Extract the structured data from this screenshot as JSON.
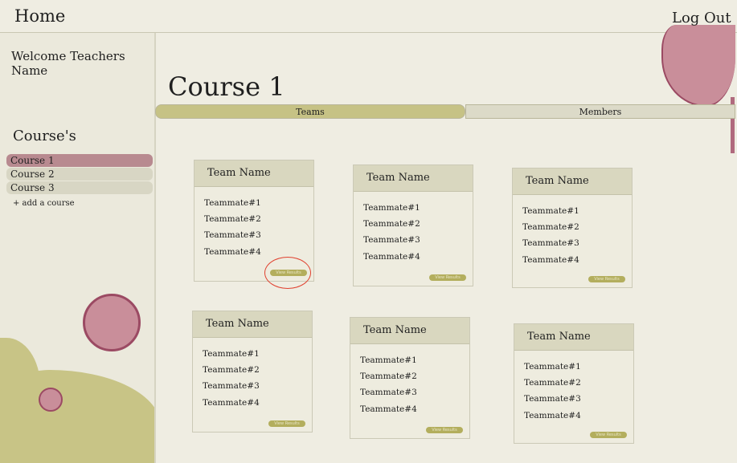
{
  "topbar": {
    "home_label": "Home",
    "logout_label": "Log Out"
  },
  "sidebar": {
    "welcome": "Welcome Teachers Name",
    "courses_heading": "Course's",
    "courses": [
      "Course 1",
      "Course 2",
      "Course 3"
    ],
    "active_course_index": 0,
    "add_course_label": "+ add a course"
  },
  "main": {
    "course_title": "Course 1",
    "tabs": [
      {
        "label": "Teams",
        "active": true
      },
      {
        "label": "Members",
        "active": false
      }
    ],
    "teams": [
      {
        "name": "Team Name",
        "members": [
          "Teammate#1",
          "Teammate#2",
          "Teammate#3",
          "Teammate#4"
        ],
        "button_label": "View Results"
      },
      {
        "name": "Team Name",
        "members": [
          "Teammate#1",
          "Teammate#2",
          "Teammate#3",
          "Teammate#4"
        ],
        "button_label": "View Results"
      },
      {
        "name": "Team Name",
        "members": [
          "Teammate#1",
          "Teammate#2",
          "Teammate#3",
          "Teammate#4"
        ],
        "button_label": "View Results"
      },
      {
        "name": "Team Name",
        "members": [
          "Teammate#1",
          "Teammate#2",
          "Teammate#3",
          "Teammate#4"
        ],
        "button_label": "View Results"
      },
      {
        "name": "Team Name",
        "members": [
          "Teammate#1",
          "Teammate#2",
          "Teammate#3",
          "Teammate#4"
        ],
        "button_label": "View Results"
      },
      {
        "name": "Team Name",
        "members": [
          "Teammate#1",
          "Teammate#2",
          "Teammate#3",
          "Teammate#4"
        ],
        "button_label": "View Results"
      }
    ]
  },
  "colors": {
    "background": "#efede2",
    "accent_olive": "#c6c285",
    "accent_rose": "#c98e9a",
    "accent_plum": "#9b4a63",
    "highlight_red": "#e0412f"
  }
}
